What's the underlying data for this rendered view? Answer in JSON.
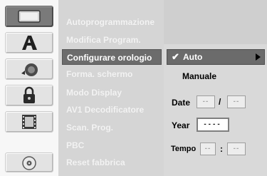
{
  "icons": [
    {
      "name": "setup-general-icon",
      "selected": true
    },
    {
      "name": "language-icon",
      "selected": false
    },
    {
      "name": "audio-icon",
      "selected": false
    },
    {
      "name": "lock-icon",
      "selected": false
    },
    {
      "name": "recording-icon",
      "selected": false
    },
    {
      "name": "disc-icon",
      "selected": false
    }
  ],
  "menu": {
    "items": [
      "Autoprogrammazione",
      "Modifica Program.",
      "Configurare orologio",
      "Forma. schermo",
      "Modo Display",
      "AV1 Decodificatore",
      "Scan. Prog.",
      "PBC",
      "Reset fabbrica"
    ],
    "selected_index": 2
  },
  "submenu": {
    "auto_label": "Auto",
    "check_glyph": "✔",
    "manual_label": "Manuale",
    "date_label": "Date",
    "date_day": "--",
    "date_separator": "/",
    "date_month": "--",
    "year_label": "Year",
    "year_value": "----",
    "time_label": "Tempo",
    "time_hour": "--",
    "time_separator": ":",
    "time_minute": "--"
  },
  "colors": {
    "selected_bg": "#6b6b6b",
    "menu_text": "#f3f3f3"
  }
}
